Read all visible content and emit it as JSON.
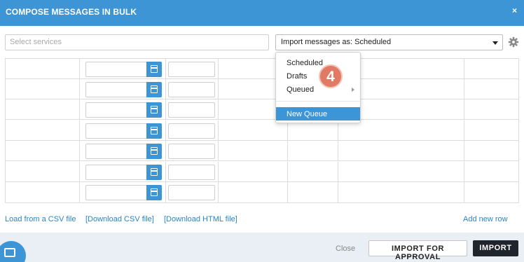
{
  "dialog": {
    "title": "COMPOSE MESSAGES IN BULK",
    "close_symbol": "×"
  },
  "toolbar": {
    "services_placeholder": "Select services",
    "import_select_value": "Import messages as: Scheduled",
    "settings_icon": "gear-icon"
  },
  "dropdown": {
    "items": [
      {
        "label": "Scheduled"
      },
      {
        "label": "Drafts"
      },
      {
        "label": "Queued",
        "has_submenu": true
      },
      {
        "label": "New Queue",
        "highlighted": true
      }
    ]
  },
  "annotation": {
    "step_number": "4",
    "color": "#e07a64"
  },
  "grid": {
    "row_count": 7,
    "row_icons": "calendar-icon"
  },
  "links": {
    "load_csv": "Load from a CSV file",
    "download_csv": "[Download CSV file]",
    "download_html": "[Download HTML file]",
    "add_row": "Add new row"
  },
  "footer": {
    "close_label": "Close",
    "import_approval_label": "IMPORT FOR APPROVAL",
    "import_label": "IMPORT"
  },
  "colors": {
    "accent": "#3d95d6",
    "link": "#2a84c6",
    "primary_button": "#20242c"
  }
}
